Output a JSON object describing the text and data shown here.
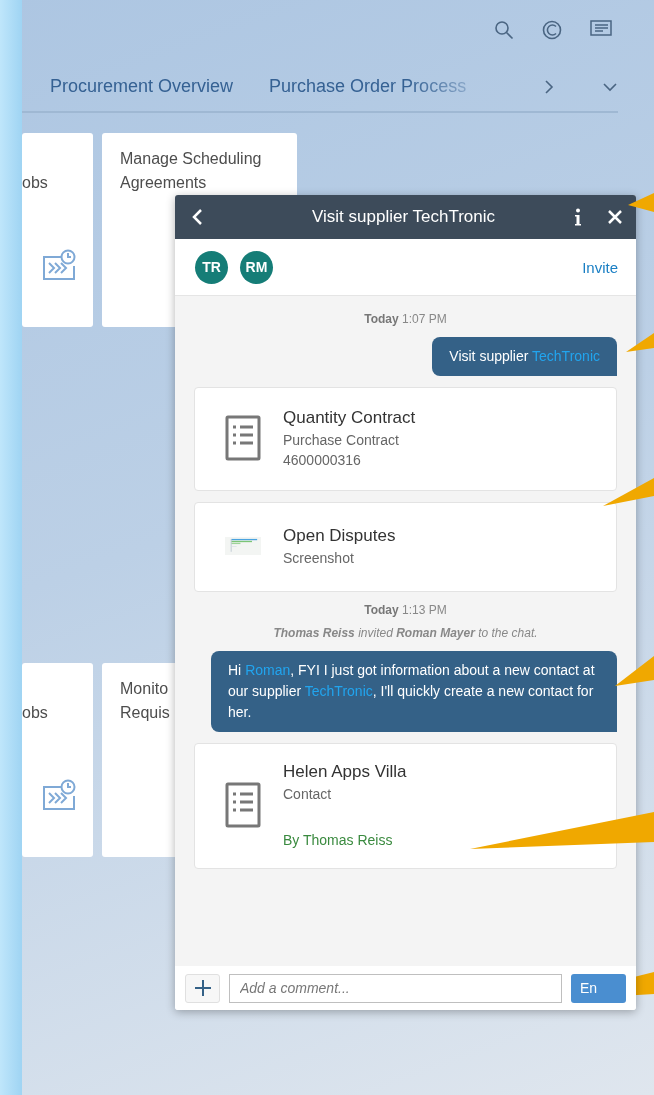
{
  "tabs": [
    {
      "label": "Procurement Overview"
    },
    {
      "label": "Purchase Order Process"
    }
  ],
  "tile_rows": [
    {
      "tiles": [
        {
          "kind": "icon",
          "lines": [
            "obs"
          ]
        },
        {
          "kind": "text",
          "lines": [
            "Manage Scheduling",
            "Agreements"
          ]
        }
      ]
    },
    {
      "tiles": [
        {
          "kind": "icon",
          "lines": [
            "obs"
          ]
        },
        {
          "kind": "text",
          "lines": [
            "Monito",
            "Requis"
          ]
        }
      ]
    }
  ],
  "chat": {
    "title": "Visit supplier TechTronic",
    "participants": [
      {
        "initials": "TR"
      },
      {
        "initials": "RM"
      }
    ],
    "invite": "Invite",
    "messages": [
      {
        "kind": "timestamp",
        "text": "**Today** 1:07 PM"
      },
      {
        "kind": "bubble",
        "parts": [
          {
            "text": "Visit supplier "
          },
          {
            "text": "TechTronic",
            "mention": true
          }
        ]
      },
      {
        "kind": "document-card",
        "title": "Quantity Contract",
        "subtitle": "Purchase Contract",
        "detail": "4600000316"
      },
      {
        "kind": "screenshot-card",
        "title": "Open Disputes",
        "subtitle": "Screenshot"
      },
      {
        "kind": "timestamp",
        "text": "**Today** 1:13 PM"
      },
      {
        "kind": "system",
        "text": "**Thomas Reiss** invited **Roman Mayer** to the chat."
      },
      {
        "kind": "bubble",
        "parts": [
          {
            "text": "Hi "
          },
          {
            "text": "Roman",
            "mention": true
          },
          {
            "text": ", FYI I just got information about a new contact at our supplier "
          },
          {
            "text": "TechTronic",
            "mention": true
          },
          {
            "text": ", I'll quickly create a new contact for her."
          }
        ]
      },
      {
        "kind": "document-card",
        "title": "Helen Apps Villa",
        "subtitle": "Contact",
        "author": "By Thomas Reiss"
      }
    ],
    "comment": {
      "placeholder": "Add a comment..."
    },
    "send": "En"
  }
}
